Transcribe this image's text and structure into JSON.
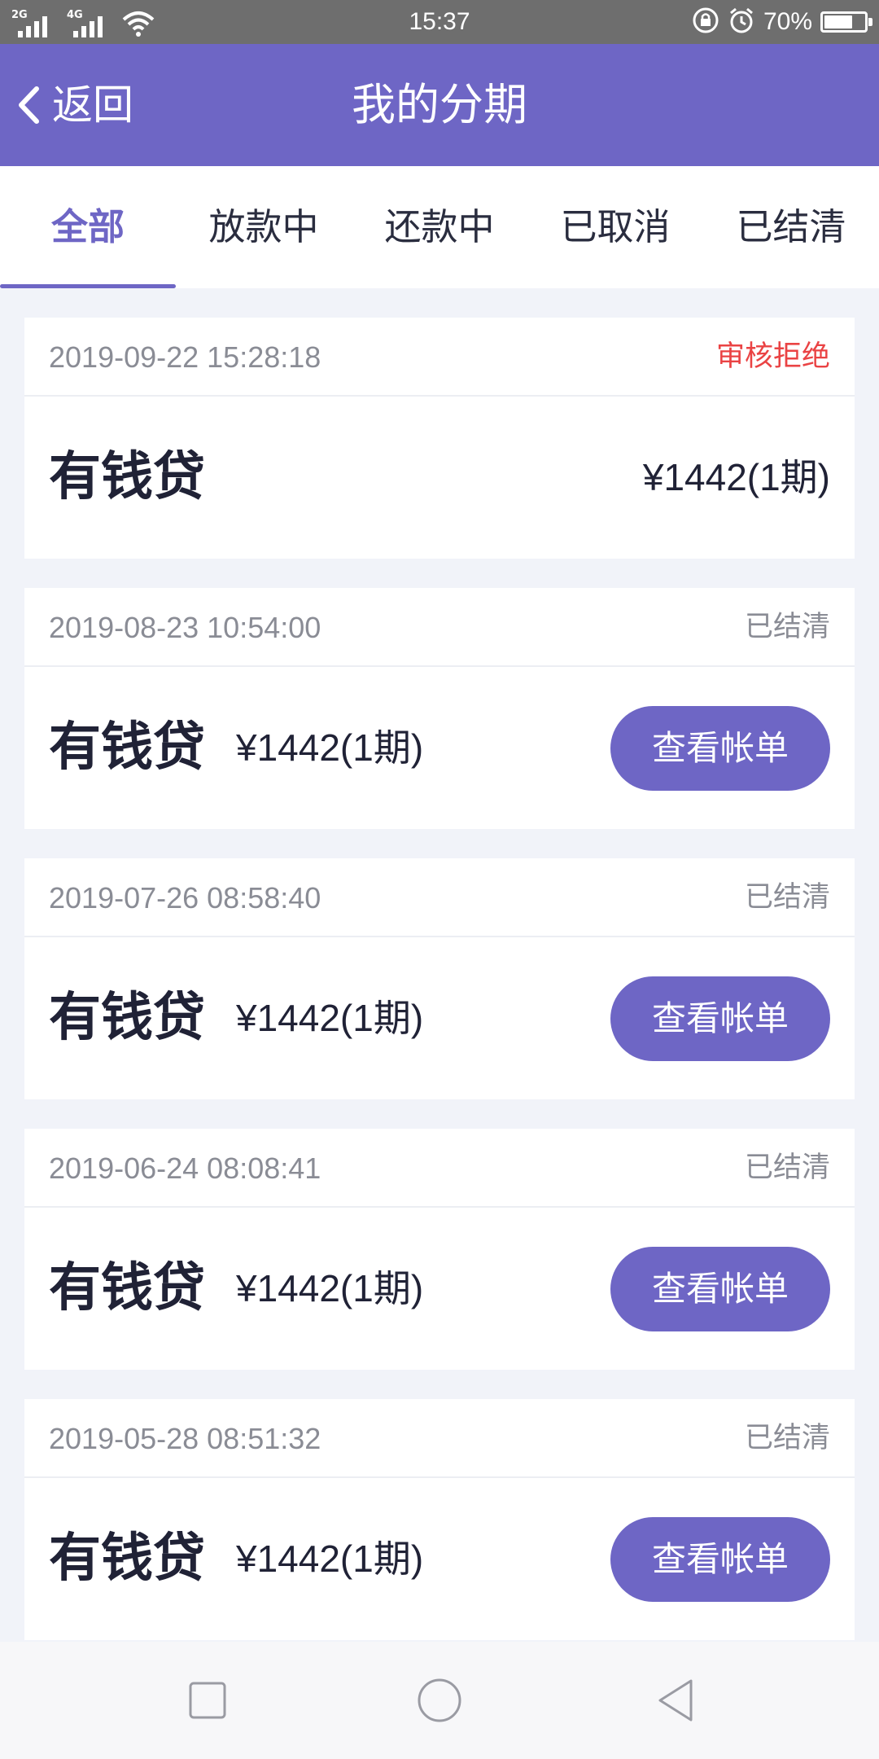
{
  "status_bar": {
    "net_left": "2G",
    "net_right": "4G",
    "time": "15:37",
    "battery_percent": "70%",
    "battery_level": 0.7,
    "icons": [
      "signal-icon",
      "wifi-icon",
      "lock-rotation-icon",
      "alarm-icon",
      "battery-icon"
    ]
  },
  "header": {
    "back_label": "返回",
    "title": "我的分期"
  },
  "tabs": [
    {
      "label": "全部",
      "active": true
    },
    {
      "label": "放款中",
      "active": false
    },
    {
      "label": "还款中",
      "active": false
    },
    {
      "label": "已取消",
      "active": false
    },
    {
      "label": "已结清",
      "active": false
    }
  ],
  "orders": [
    {
      "date": "2019-09-22 15:28:18",
      "status": "审核拒绝",
      "product": "有钱贷",
      "amount": "¥1442(1期)",
      "button": ""
    },
    {
      "date": "2019-08-23 10:54:00",
      "status": "已结清",
      "product": "有钱贷",
      "amount": "¥1442(1期)",
      "button": "查看帐单"
    },
    {
      "date": "2019-07-26 08:58:40",
      "status": "已结清",
      "product": "有钱贷",
      "amount": "¥1442(1期)",
      "button": "查看帐单"
    },
    {
      "date": "2019-06-24 08:08:41",
      "status": "已结清",
      "product": "有钱贷",
      "amount": "¥1442(1期)",
      "button": "查看帐单"
    },
    {
      "date": "2019-05-28 08:51:32",
      "status": "已结清",
      "product": "有钱贷",
      "amount": "¥1442(1期)",
      "button": "查看帐单"
    }
  ],
  "colors": {
    "accent": "#6e66c5",
    "rejected": "#ea4344",
    "muted": "#8a8c95",
    "text": "#202236",
    "page_bg": "#f1f3f9"
  },
  "nav_bar": {
    "icons": [
      "recent-apps-icon",
      "home-icon",
      "back-icon"
    ]
  }
}
